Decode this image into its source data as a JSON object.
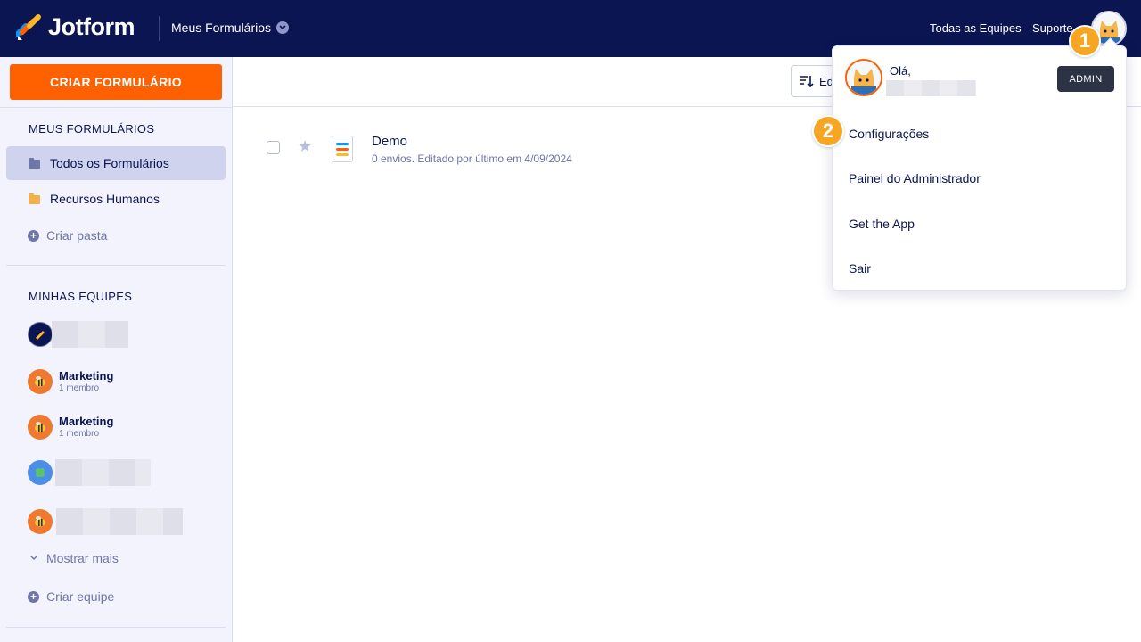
{
  "brand": {
    "name": "Jotform"
  },
  "topnav": {
    "forms_menu": "Meus Formulários",
    "all_teams": "Todas as Equipes",
    "support": "Suporte"
  },
  "sidebar": {
    "create_button": "CRIAR FORMULÁRIO",
    "my_forms_heading": "MEUS FORMULÁRIOS",
    "folders": [
      {
        "label": "Todos os Formulários",
        "color": "#6f76a7",
        "active": true
      },
      {
        "label": "Recursos Humanos",
        "color": "#f4b04a",
        "active": false
      }
    ],
    "create_folder": "Criar pasta",
    "my_teams_heading": "MINHAS EQUIPES",
    "teams": [
      {
        "name": "Marketing",
        "members": "1 membro",
        "icon": "bee-icon"
      },
      {
        "name": "Marketing",
        "members": "1 membro",
        "icon": "bee-icon"
      }
    ],
    "show_more": "Mostrar mais",
    "create_team": "Criar equipe"
  },
  "toolbar": {
    "sort_label": "Ed"
  },
  "forms": [
    {
      "title": "Demo",
      "meta": "0 envios. Editado por último em 4/09/2024"
    }
  ],
  "account_menu": {
    "greeting": "Olá,",
    "role_badge": "ADMIN",
    "items": [
      "Configurações",
      "Painel do Administrador",
      "Get the App",
      "Sair"
    ]
  },
  "step_badges": [
    "1",
    "2"
  ],
  "colors": {
    "nav_bg": "#0a1551",
    "accent": "#ff6100",
    "badge": "#f6a623",
    "sidebar_bg": "#f3f3fe"
  }
}
